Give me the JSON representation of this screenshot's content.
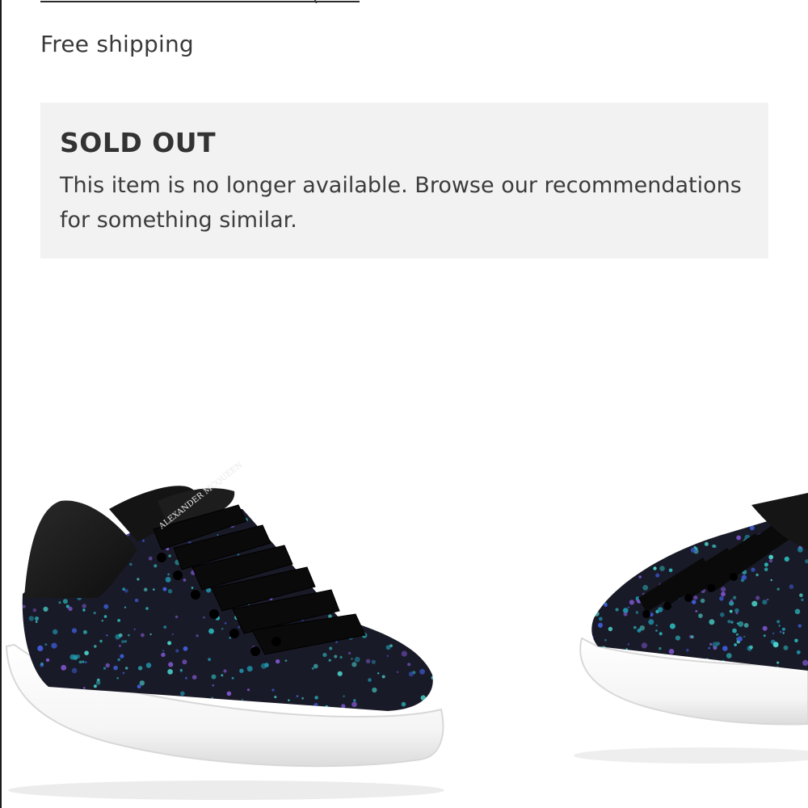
{
  "top_fragment": "(",
  "shipping_text": "Free shipping",
  "sold_out": {
    "title": "SOLD OUT",
    "message": "This item is no longer available. Browse our recommendations for something similar."
  },
  "product_images": [
    {
      "name": "sneaker-left",
      "brand_text": "ALEXANDER MCQUEEN"
    },
    {
      "name": "sneaker-right"
    }
  ],
  "colors": {
    "panel_bg": "#f2f2f2",
    "text": "#393939",
    "sole": "#ffffff",
    "glitter_base": "#1c1d2a",
    "glitter_teal": "#2bb3b8",
    "glitter_blue": "#3d5bd6",
    "glitter_purple": "#7a54c9"
  }
}
